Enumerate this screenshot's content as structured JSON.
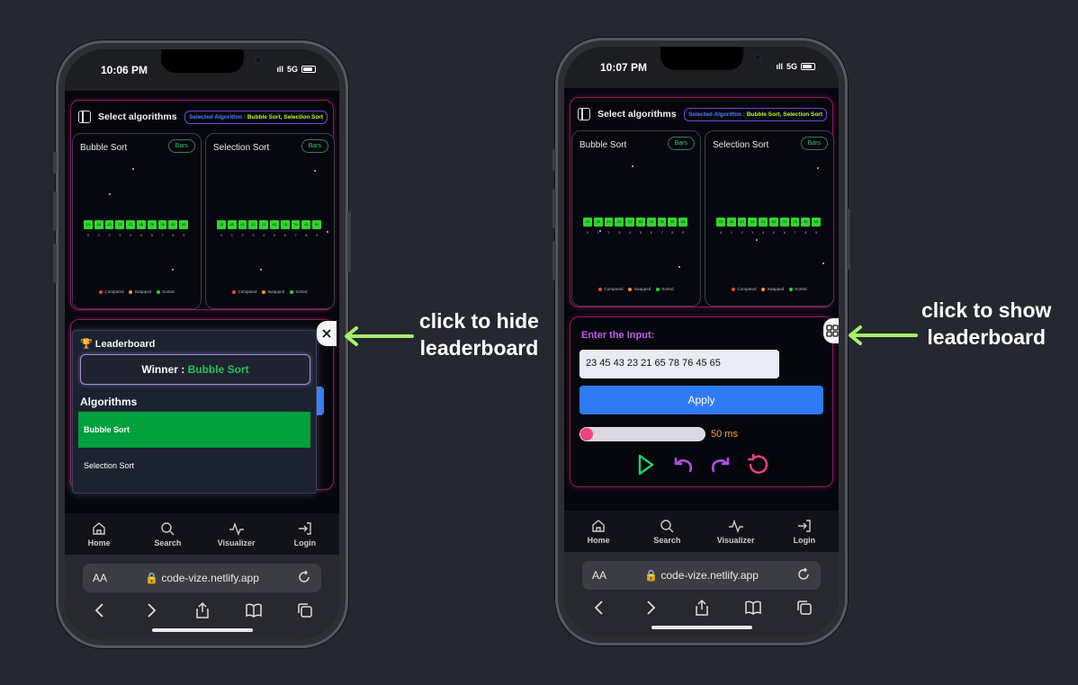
{
  "common": {
    "select_title": "Select algorithms",
    "selected_prefix": "Selected Algorithm : ",
    "selected_value": "Bubble Sort, Selection Sort",
    "algo1": "Bubble Sort",
    "algo2": "Selection Sort",
    "mode_label": "Bars",
    "bar_values": [
      "23",
      "45",
      "43",
      "23",
      "21",
      "65",
      "78",
      "76",
      "45",
      "65"
    ],
    "bar_indexes": [
      "0",
      "1",
      "2",
      "3",
      "4",
      "5",
      "6",
      "7",
      "8",
      "9"
    ],
    "legend": [
      "Compared",
      "Swapped",
      "Sorted"
    ],
    "legend_colors": [
      "#e64a3a",
      "#f29a2e",
      "#2ed72e"
    ],
    "enter_label": "Enter the Input:",
    "input_value": "23 45 43 23 21 65 78 76 45 65",
    "apply_label": "Apply",
    "speed_label": "50 ms",
    "tabs": [
      "Home",
      "Search",
      "Visualizer",
      "Login"
    ],
    "aa": "AA",
    "url": "code-vize.netlify.app",
    "signal": "5G"
  },
  "left": {
    "time": "10:06 PM",
    "caption_line1": "click to hide",
    "caption_line2": "leaderboard",
    "leaderboard_title": "🏆 Leaderboard",
    "winner_prefix": "Winner : ",
    "winner_value": "Bubble Sort",
    "algorithms_heading": "Algorithms",
    "rows": [
      "Bubble Sort",
      "Selection Sort"
    ]
  },
  "right": {
    "time": "10:07 PM",
    "caption_line1": "click to show",
    "caption_line2": "leaderboard"
  }
}
